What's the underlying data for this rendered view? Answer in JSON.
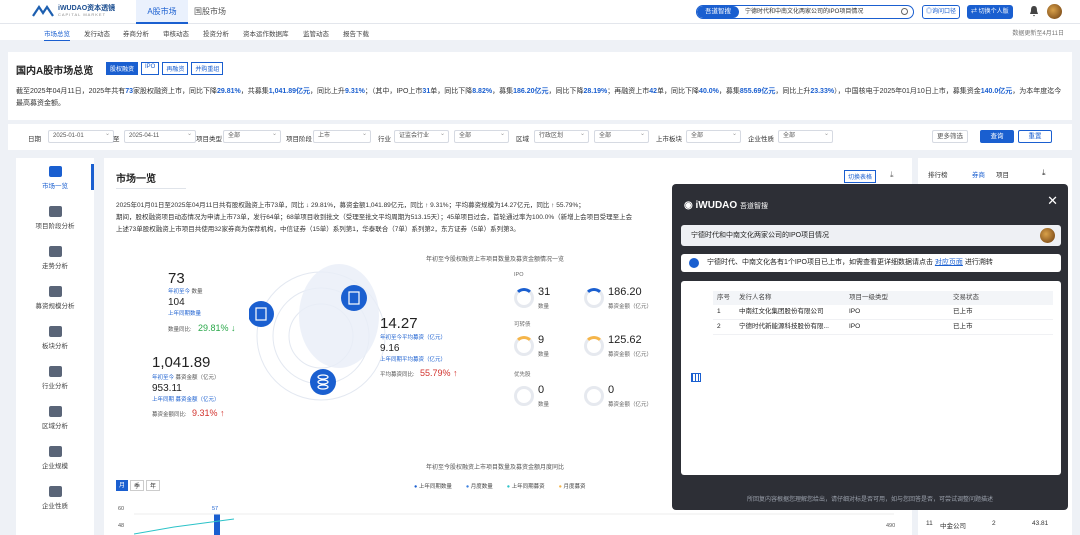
{
  "brand": {
    "name": "iWUDAO资本透镜",
    "sub": "CAPITAL MARKET"
  },
  "top_tabs": [
    "A股市场",
    "国股市场"
  ],
  "search": {
    "pill": "吾道智搜",
    "query": "宁德时代和中南文化两家公司的IPO项目情况"
  },
  "top_buttons": {
    "ask": "◎询问口径",
    "switch": "⇄ 切换个人版"
  },
  "subnav": [
    "市场总览",
    "发行动态",
    "券商分析",
    "审核动态",
    "投资分析",
    "资本运作数据库",
    "监管动态",
    "报告下载"
  ],
  "update_text": "数据更新至4月11日",
  "overview": {
    "title": "国内A股市场总览",
    "chips": [
      "股权融资",
      "IPO",
      "再融资",
      "并购重组"
    ],
    "summary_parts": [
      [
        "截至2025年04月11日，2025年共有",
        ""
      ],
      [
        "73",
        "b"
      ],
      [
        "家股权融资上市，同比下降",
        ""
      ],
      [
        "29.81%",
        "b"
      ],
      [
        "，共募集",
        ""
      ],
      [
        "1,041.89亿元",
        "b"
      ],
      [
        "，同比上升",
        ""
      ],
      [
        "9.31%",
        "b"
      ],
      [
        "；（其中，IPO上市",
        ""
      ],
      [
        "31",
        "b"
      ],
      [
        "单，同比下降",
        ""
      ],
      [
        "8.82%",
        "b"
      ],
      [
        "，募集",
        ""
      ],
      [
        "186.20亿元",
        "b"
      ],
      [
        "，同比下降",
        ""
      ],
      [
        "28.19%",
        "b"
      ],
      [
        "；再融资上市",
        ""
      ],
      [
        "42",
        "b"
      ],
      [
        "单，同比下降",
        ""
      ],
      [
        "40.0%",
        "b"
      ],
      [
        "，募集",
        ""
      ],
      [
        "855.69亿元",
        "b"
      ],
      [
        "，同比上升",
        ""
      ],
      [
        "23.33%",
        "b"
      ],
      [
        "），中国核电于2025年01月10日上市，募集资金",
        ""
      ],
      [
        "140.0亿元",
        "b"
      ],
      [
        "，为本年度迄今最高募资金额。",
        ""
      ]
    ]
  },
  "filters": {
    "date_label": "日期",
    "date_from": "2025-01-01",
    "to": "至",
    "date_to": "2025-04-11",
    "proj_type_label": "项目类型",
    "proj_type": "全部",
    "proj_stage_label": "项目阶段",
    "proj_stage": "上市",
    "industry_label": "行业",
    "industry": "证监会行业",
    "industry2": "全部",
    "region_label": "区域",
    "region": "行政区划",
    "region2": "全部",
    "board_label": "上市板块",
    "board": "全部",
    "nature_label": "企业性质",
    "nature": "全部",
    "more": "更多筛选",
    "query": "查询",
    "reset": "重置"
  },
  "sidenav": [
    "市场一览",
    "项目阶段分析",
    "走势分析",
    "募资规模分析",
    "板块分析",
    "行业分析",
    "区域分析",
    "企业规模",
    "企业性质"
  ],
  "main": {
    "title": "市场一览",
    "switch": "切换表格",
    "download": "⤓",
    "text_l1": "2025年01月01日至2025年04月11日共有股权融资上市73单，同比 ↓ 29.81%，募资金额1,041.89亿元，同比 ↑ 9.31%；平均募资规模为14.27亿元，同比 ↑ 55.79%；",
    "text_l2": "期间，股权融资项目动态情况为申请上市73单，发行64单；68单项目收到批文（受理至批文平均周期为513.15天）；45单项目过会，首轮通过率为100.0%（新增上会项目受理至上会",
    "text_l3": "上述73单股权融资上市项目共使用32家券商为保荐机构，中信证券（15单）系列第1，华泰联合（7单）系列第2，东方证券（5单）系列第3。",
    "chart_title": "年初至今股权融资上市项目数量及募资金额情况一览",
    "count": "73",
    "count_lbl": "年初至今",
    "count_unit": "数量",
    "prev_count": "104",
    "prev_lbl": "上年同期数量",
    "count_yoy_lbl": "数量同比:",
    "count_yoy": "29.81% ↓",
    "amount": "1,041.89",
    "amount_lbl": "年初至今",
    "amount_unit": "募资金额（亿元）",
    "prev_amount": "953.11",
    "prev_amount_lbl": "上年同期 募资金额（亿元）",
    "amount_yoy_lbl": "募资金额同比:",
    "amount_yoy": "9.31% ↑",
    "avg": "14.27",
    "avg_lbl": "年初至今平均募资（亿元）",
    "prev_avg": "9.16",
    "prev_avg_lbl": "上年同期平均募资（亿元）",
    "avg_yoy_lbl": "平均募资同比:",
    "avg_yoy": "55.79% ↑",
    "groups": [
      {
        "name": "IPO",
        "count": "31",
        "amount": "186.20"
      },
      {
        "name": "可转债",
        "count": "9",
        "amount": "125.62"
      },
      {
        "name": "优先股",
        "count": "0",
        "amount": "0"
      }
    ],
    "count_lbl_s": "数量",
    "amount_lbl_s": "募资金额（亿元）",
    "chart2_title": "年初至今股权融资上市项目数量及募资金额月度同比",
    "chart2_tabs": [
      "月",
      "季",
      "年"
    ],
    "legend": [
      "上年同期数量",
      "月度数量",
      "上年同期募资",
      "月度募资"
    ],
    "y_left": [
      "60",
      "48"
    ],
    "y_right": [
      "490"
    ],
    "bar_label": "57"
  },
  "rpanel": {
    "tabs": [
      "排行榜",
      "券商",
      "项目"
    ],
    "download": "⤓",
    "row": [
      "11",
      "中金公司",
      "2",
      "43.81"
    ]
  },
  "assistant": {
    "logo": "iWUDAO",
    "title": "吾道智搜",
    "question": "宁德时代和中南文化两家公司的IPO项目情况",
    "answer_pre": "宁德时代、中南文化各有1个IPO项目已上市，如需查看更详细数据请点击",
    "answer_link": "对应页面",
    "answer_post": "进行溯转",
    "columns": [
      "序号",
      "发行人名称",
      "项目一级类型",
      "交易状态"
    ],
    "rows": [
      [
        "1",
        "中南红文化集团股份有限公司",
        "IPO",
        "已上市"
      ],
      [
        "2",
        "宁德时代新能源科技股份有限...",
        "IPO",
        "已上市"
      ]
    ],
    "footer": "所回复内容根据您理解您给出，请仔细对标是否可用，如与您回答是否，可尝试调整问题描述"
  }
}
